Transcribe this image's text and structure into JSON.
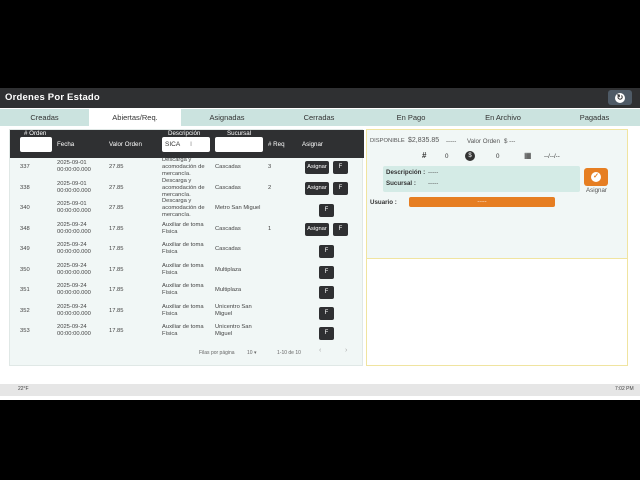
{
  "app": {
    "title": "Ordenes Por Estado"
  },
  "tabs": [
    "Creadas",
    "Abiertas/Req.",
    "Asignadas",
    "Cerradas",
    "En Pago",
    "En Archivo",
    "Pagadas"
  ],
  "table": {
    "headers": {
      "orden": "# Orden",
      "fecha": "Fecha",
      "valor": "Valor Orden",
      "descripcion": "Descripción",
      "sucursal": "Sucursal",
      "req": "# Req",
      "asignar": "Asignar"
    },
    "filter_descripcion_value": "SICA",
    "rows": [
      {
        "orden": "337",
        "fecha1": "2025-09-01",
        "fecha2": "00:00:00.000",
        "valor": "27.85",
        "desc": [
          "Descarga y",
          "acomodación de",
          "mercancía."
        ],
        "suc": [
          "Cascadas"
        ],
        "req": "3",
        "asignar": true
      },
      {
        "orden": "338",
        "fecha1": "2025-09-01",
        "fecha2": "00:00:00.000",
        "valor": "27.85",
        "desc": [
          "Descarga y",
          "acomodación de",
          "mercancía."
        ],
        "suc": [
          "Cascadas"
        ],
        "req": "2",
        "asignar": true
      },
      {
        "orden": "340",
        "fecha1": "2025-09-01",
        "fecha2": "00:00:00.000",
        "valor": "27.85",
        "desc": [
          "Descarga y",
          "acomodación de",
          "mercancía."
        ],
        "suc": [
          "Metro San Miguel"
        ],
        "req": "",
        "asignar": false
      },
      {
        "orden": "348",
        "fecha1": "2025-09-24",
        "fecha2": "00:00:00.000",
        "valor": "17.85",
        "desc": [
          "Auxiliar de toma",
          "Física"
        ],
        "suc": [
          "Cascadas"
        ],
        "req": "1",
        "asignar": true
      },
      {
        "orden": "349",
        "fecha1": "2025-09-24",
        "fecha2": "00:00:00.000",
        "valor": "17.85",
        "desc": [
          "Auxiliar de toma",
          "Física"
        ],
        "suc": [
          "Cascadas"
        ],
        "req": "",
        "asignar": false
      },
      {
        "orden": "350",
        "fecha1": "2025-09-24",
        "fecha2": "00:00:00.000",
        "valor": "17.85",
        "desc": [
          "Auxiliar de toma",
          "Física"
        ],
        "suc": [
          "Multiplaza"
        ],
        "req": "",
        "asignar": false
      },
      {
        "orden": "351",
        "fecha1": "2025-09-24",
        "fecha2": "00:00:00.000",
        "valor": "17.85",
        "desc": [
          "Auxiliar de toma",
          "Física"
        ],
        "suc": [
          "Multiplaza"
        ],
        "req": "",
        "asignar": false
      },
      {
        "orden": "352",
        "fecha1": "2025-09-24",
        "fecha2": "00:00:00.000",
        "valor": "17.85",
        "desc": [
          "Auxiliar de toma",
          "Física"
        ],
        "suc": [
          "Unicentro San",
          "Miguel"
        ],
        "req": "",
        "asignar": false
      },
      {
        "orden": "353",
        "fecha1": "2025-09-24",
        "fecha2": "00:00:00.000",
        "valor": "17.85",
        "desc": [
          "Auxiliar de toma",
          "Física"
        ],
        "suc": [
          "Unicentro San",
          "Miguel"
        ],
        "req": "",
        "asignar": false
      }
    ],
    "asignar_label": "Asignar",
    "f_label": "F"
  },
  "pagination": {
    "rows_label": "Filas por página",
    "rows_value": "10",
    "range": "1-10 de 10"
  },
  "detail": {
    "disponible_label": "DISPONIBLE",
    "disponible_value": "$2,835.85",
    "dashes": "-----",
    "valor_orden_label": "Valor Orden",
    "valor_orden_value": "$ ---",
    "hash_count": "0",
    "money_count": "0",
    "date_value": "--/--/--",
    "descripcion_label": "Descripción :",
    "descripcion_value": "-----",
    "sucursal_label": "Sucursal :",
    "sucursal_value": "-----",
    "asignar_label": "Asignar",
    "usuario_label": "Usuario :",
    "usuario_value": "-----"
  },
  "taskbar": {
    "left_text": "22°F",
    "time": "7:02 PM"
  }
}
